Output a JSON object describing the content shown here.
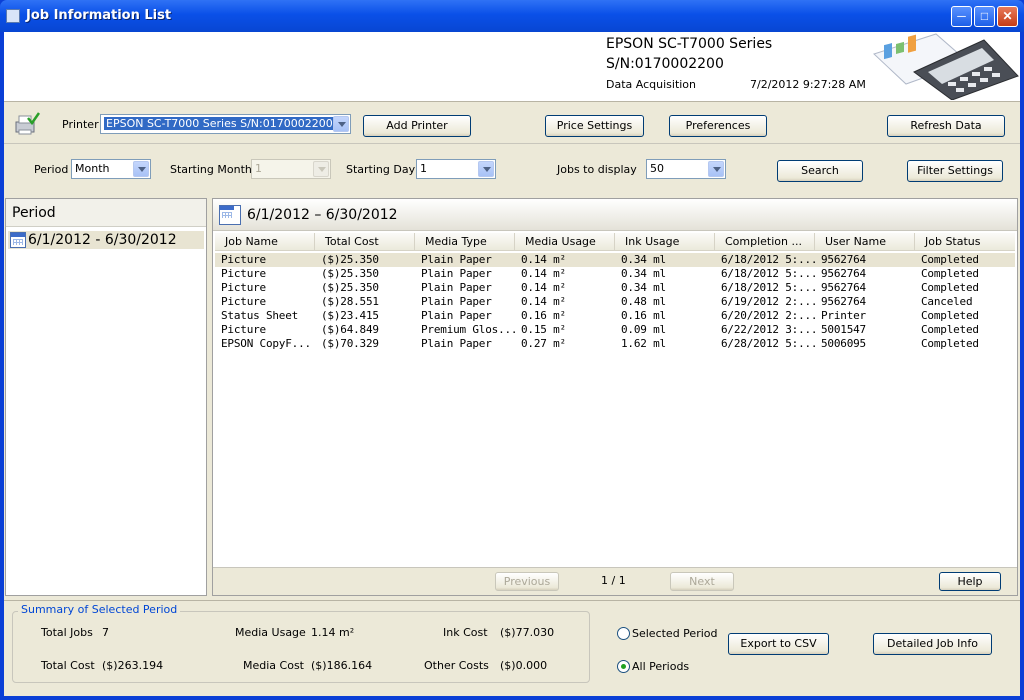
{
  "window": {
    "title": "Job Information List"
  },
  "header": {
    "model": "EPSON SC-T7000 Series",
    "serial": "S/N:0170002200",
    "acquisition_label": "Data Acquisition",
    "acquisition_date": "7/2/2012 9:27:28 AM"
  },
  "toolbar": {
    "printer_label": "Printer",
    "printer_value": "EPSON SC-T7000 Series S/N:0170002200",
    "add_printer": "Add Printer",
    "price_settings": "Price Settings",
    "preferences": "Preferences",
    "refresh_data": "Refresh Data"
  },
  "filters": {
    "period_label": "Period",
    "period_value": "Month",
    "starting_month_label": "Starting Month",
    "starting_month_value": "1",
    "starting_day_label": "Starting Day",
    "starting_day_value": "1",
    "jobs_to_display_label": "Jobs to display",
    "jobs_to_display_value": "50",
    "search": "Search",
    "filter_settings": "Filter Settings"
  },
  "period_pane": {
    "title": "Period",
    "item": "6/1/2012 - 6/30/2012"
  },
  "jobs_pane": {
    "title": "6/1/2012 – 6/30/2012",
    "columns": [
      "Job Name",
      "Total Cost",
      "Media Type",
      "Media Usage",
      "Ink Usage",
      "Completion ...",
      "User Name",
      "Job Status"
    ],
    "rows": [
      [
        "Picture",
        "($)25.350",
        "Plain Paper",
        "0.14 m²",
        "0.34 ml",
        "6/18/2012 5:...",
        "9562764",
        "Completed"
      ],
      [
        "Picture",
        "($)25.350",
        "Plain Paper",
        "0.14 m²",
        "0.34 ml",
        "6/18/2012 5:...",
        "9562764",
        "Completed"
      ],
      [
        "Picture",
        "($)25.350",
        "Plain Paper",
        "0.14 m²",
        "0.34 ml",
        "6/18/2012 5:...",
        "9562764",
        "Completed"
      ],
      [
        "Picture",
        "($)28.551",
        "Plain Paper",
        "0.14 m²",
        "0.48 ml",
        "6/19/2012 2:...",
        "9562764",
        "Canceled"
      ],
      [
        "Status Sheet",
        "($)23.415",
        "Plain Paper",
        "0.16 m²",
        "0.16 ml",
        "6/20/2012 2:...",
        "Printer",
        "Completed"
      ],
      [
        "Picture",
        "($)64.849",
        "Premium Glos...",
        "0.15 m²",
        "0.09 ml",
        "6/22/2012 3:...",
        "5001547",
        "Completed"
      ],
      [
        "EPSON CopyF...",
        "($)70.329",
        "Plain Paper",
        "0.27 m²",
        "1.62 ml",
        "6/28/2012 5:...",
        "5006095",
        "Completed"
      ]
    ],
    "previous": "Previous",
    "page": "1 / 1",
    "next": "Next",
    "help": "Help"
  },
  "summary": {
    "legend": "Summary of Selected Period",
    "total_jobs_label": "Total Jobs",
    "total_jobs_value": "7",
    "media_usage_label": "Media Usage",
    "media_usage_value": "1.14 m²",
    "ink_cost_label": "Ink Cost",
    "ink_cost_value": "($)77.030",
    "total_cost_label": "Total Cost",
    "total_cost_value": "($)263.194",
    "media_cost_label": "Media Cost",
    "media_cost_value": "($)186.164",
    "other_costs_label": "Other Costs",
    "other_costs_value": "($)0.000",
    "selected_period": "Selected Period",
    "all_periods": "All Periods",
    "export_csv": "Export to CSV",
    "detailed_job_info": "Detailed Job Info"
  }
}
